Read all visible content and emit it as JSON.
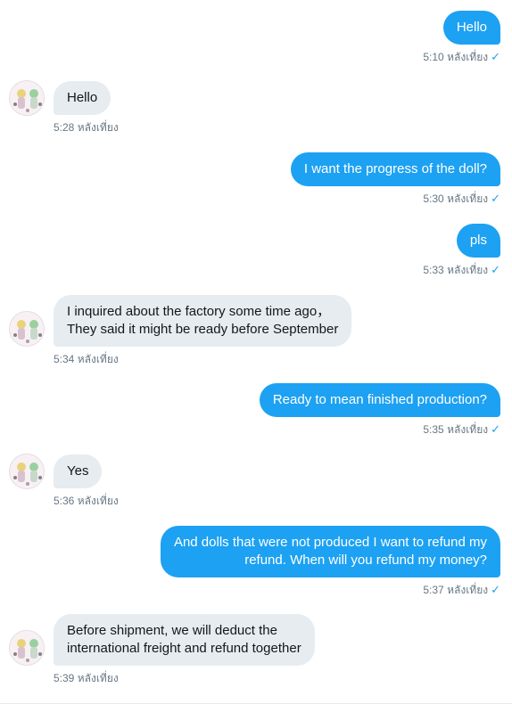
{
  "colors": {
    "outgoing_bubble": "#1da1f2",
    "incoming_bubble": "#e6ecf0",
    "timestamp_text": "#657786",
    "read_check": "#1da1f2"
  },
  "messages": [
    {
      "direction": "outgoing",
      "text": "Hello",
      "time": "5:10 หลังเที่ยง",
      "check": "✓"
    },
    {
      "direction": "incoming",
      "text": "Hello",
      "time": "5:28 หลังเที่ยง"
    },
    {
      "direction": "outgoing",
      "text": "I want the progress of the doll?",
      "time": "5:30 หลังเที่ยง",
      "check": "✓"
    },
    {
      "direction": "outgoing",
      "text": "pls",
      "time": "5:33 หลังเที่ยง",
      "check": "✓"
    },
    {
      "direction": "incoming",
      "text": "I inquired about the factory some time ago，\nThey said it might be ready before September",
      "time": "5:34 หลังเที่ยง"
    },
    {
      "direction": "outgoing",
      "text": "Ready to mean finished production?",
      "time": "5:35 หลังเที่ยง",
      "check": "✓"
    },
    {
      "direction": "incoming",
      "text": "Yes",
      "time": "5:36 หลังเที่ยง"
    },
    {
      "direction": "outgoing",
      "text": "And dolls that were not produced I want to refund my\nrefund. When will you refund my money?",
      "time": "5:37 หลังเที่ยง",
      "check": "✓"
    },
    {
      "direction": "incoming",
      "text": "Before shipment, we will deduct the\ninternational freight and refund together",
      "time": "5:39 หลังเที่ยง"
    }
  ]
}
